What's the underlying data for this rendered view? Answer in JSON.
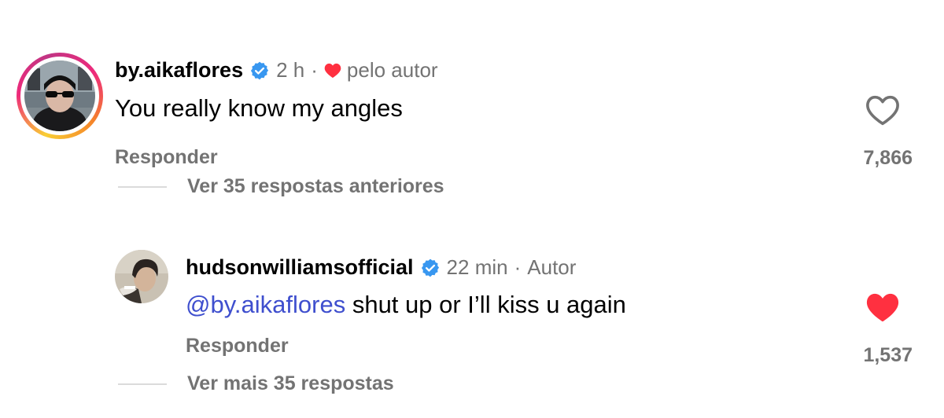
{
  "comments": [
    {
      "username": "by.aikaflores",
      "time": "2 h",
      "liked_by_author_label": "pelo autor",
      "text": "You really know my angles",
      "reply_label": "Responder",
      "like_count": "7,866",
      "liked": false,
      "view_replies_label": "Ver 35 respostas anteriores"
    },
    {
      "username": "hudsonwilliamsofficial",
      "time": "22 min",
      "author_label": "Autor",
      "mention": "@by.aikaflores",
      "text": "shut up or I’ll kiss u again",
      "reply_label": "Responder",
      "like_count": "1,537",
      "liked": true,
      "view_replies_label": "Ver mais 35 respostas"
    }
  ],
  "colors": {
    "verified": "#3897f0",
    "like_red": "#ff3040",
    "mention": "#3f4fce",
    "secondary_text": "#737373"
  },
  "icons": {
    "verified": "verified-badge-icon",
    "heart_outline": "heart-outline-icon",
    "heart_filled": "heart-filled-icon"
  }
}
